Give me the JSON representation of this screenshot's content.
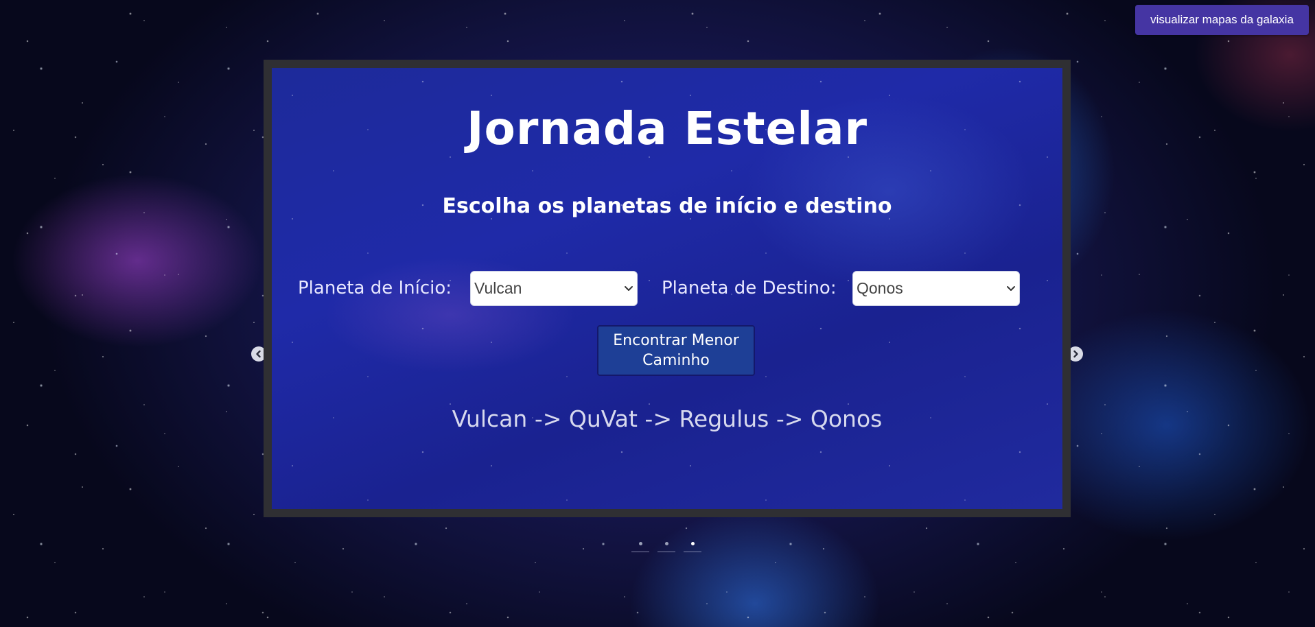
{
  "header": {
    "gallery_button_label": "visualizar mapas da galaxia"
  },
  "main": {
    "title": "Jornada Estelar",
    "subtitle": "Escolha os planetas de início e destino",
    "start_label": "Planeta de Início:",
    "start_selected": "Vulcan",
    "destination_label": "Planeta de Destino:",
    "destination_selected": "Qonos",
    "find_button_line1": "Encontrar Menor",
    "find_button_line2": "Caminho",
    "result_path": "Vulcan -> QuVat -> Regulus -> Qonos"
  },
  "carousel": {
    "prev_icon": "chevron-left-icon",
    "next_icon": "chevron-right-icon",
    "slide_count": 3,
    "active_slide": 3
  },
  "colors": {
    "gallery_button": "#4535a3",
    "frame_border": "#2f2f33",
    "find_button": "#1e3f96",
    "text_primary": "#ffffff",
    "text_secondary": "#d7d9ee"
  }
}
